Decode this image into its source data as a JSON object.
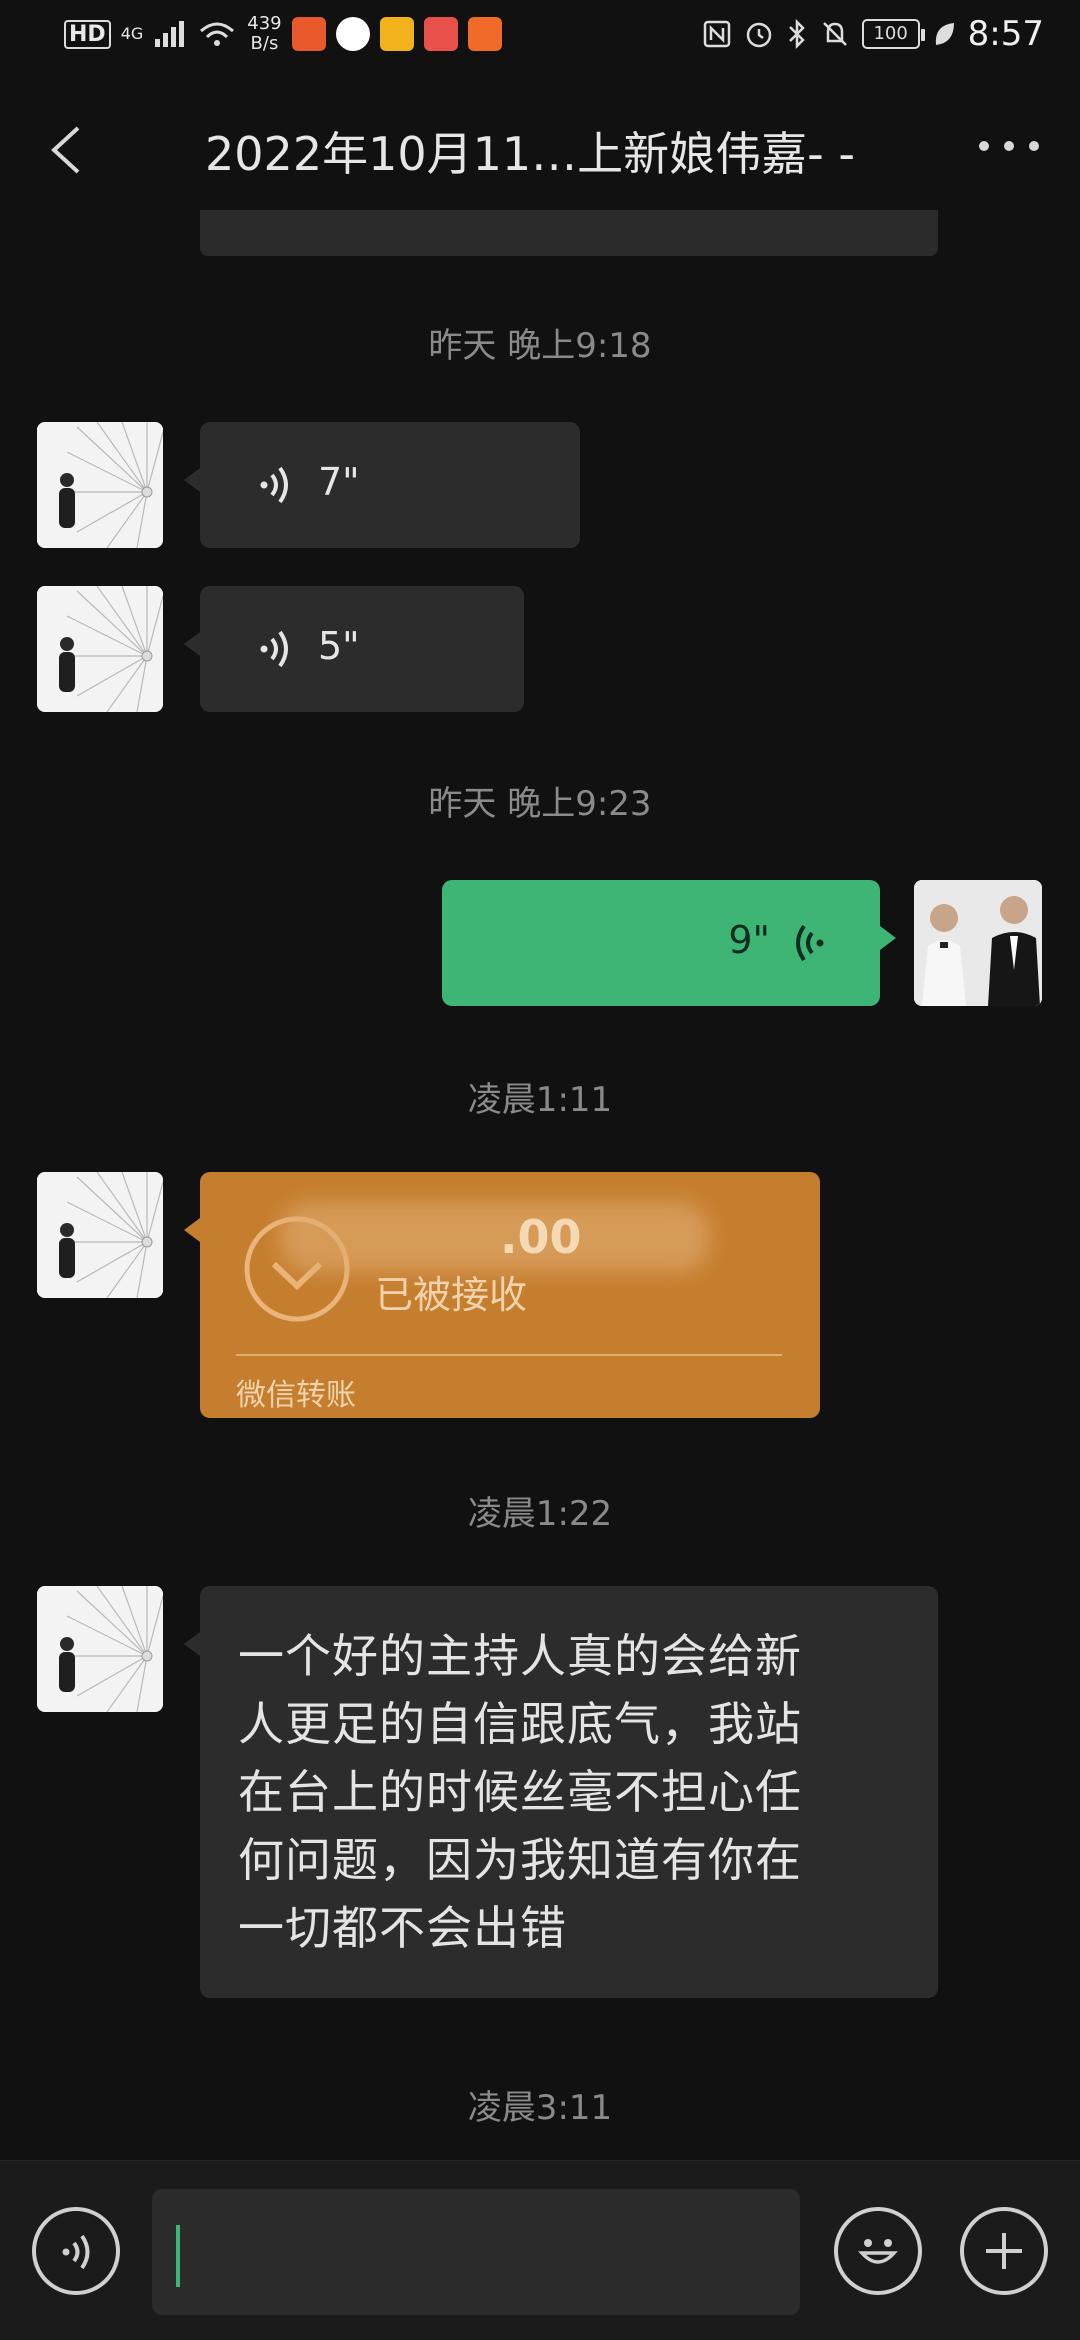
{
  "status_bar": {
    "network_type": "4G",
    "hd_label": "HD",
    "speed_value": "439",
    "speed_unit": "B/s",
    "battery": "100",
    "time": "8:57"
  },
  "header": {
    "title": "2022年10月11…上新娘伟嘉-  -"
  },
  "messages": [
    {
      "type": "timestamp",
      "text": "昨天 晚上9:18"
    },
    {
      "type": "voice",
      "side": "left",
      "duration": "7\""
    },
    {
      "type": "voice",
      "side": "left",
      "duration": "5\""
    },
    {
      "type": "timestamp",
      "text": "昨天 晚上9:23"
    },
    {
      "type": "voice",
      "side": "right",
      "duration": "9\""
    },
    {
      "type": "timestamp",
      "text": "凌晨1:11"
    },
    {
      "type": "transfer",
      "side": "left",
      "amount": ".00",
      "status": "已被接收",
      "label": "微信转账"
    },
    {
      "type": "timestamp",
      "text": "凌晨1:22"
    },
    {
      "type": "text",
      "side": "left",
      "lines": [
        "一个好的主持人真的会给新",
        "人更足的自信跟底气，我站",
        "在台上的时候丝毫不担心任",
        "何问题，因为我知道有你在",
        "一切都不会出错"
      ]
    },
    {
      "type": "timestamp",
      "text": "凌晨3:11"
    }
  ],
  "colors": {
    "background": "#111111",
    "bubble_incoming": "#2c2c2c",
    "bubble_outgoing": "#3eb575",
    "transfer": "#c57e2e"
  }
}
